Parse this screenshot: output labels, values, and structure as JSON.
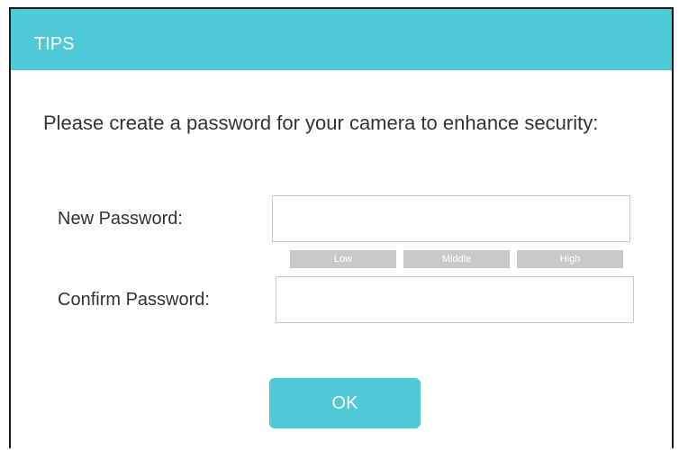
{
  "dialog": {
    "title": "TIPS",
    "message": "Please create a password for your camera to enhance security:",
    "new_password_label": "New Password:",
    "new_password_value": "",
    "confirm_password_label": "Confirm Password:",
    "confirm_password_value": "",
    "strength": {
      "low": "Low",
      "middle": "Middle",
      "high": "High"
    },
    "ok_label": "OK"
  },
  "colors": {
    "accent": "#4ecbd6",
    "strength_bar": "#c9c9c9",
    "text": "#333333"
  }
}
